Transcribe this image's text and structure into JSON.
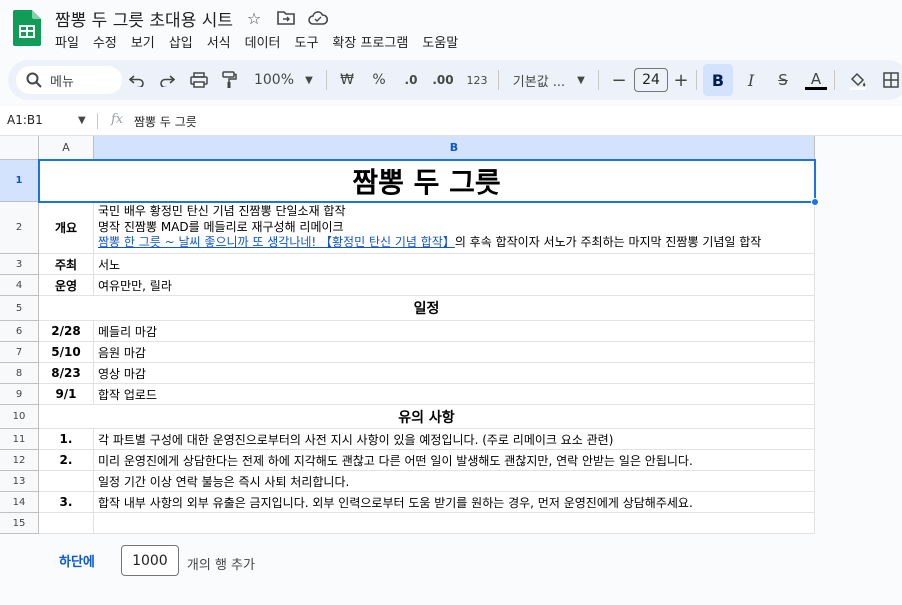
{
  "app": {
    "title": "짬뽕 두 그릇 초대용 시트",
    "colors": {
      "accent": "#1a73e8",
      "sheets_green": "#0f9d58",
      "link": "#1155cc"
    }
  },
  "menu": [
    "파일",
    "수정",
    "보기",
    "삽입",
    "서식",
    "데이터",
    "도구",
    "확장 프로그램",
    "도움말"
  ],
  "toolbar": {
    "search_label": "메뉴",
    "zoom": "100%",
    "currency": "₩",
    "percent": "%",
    "dec_decrease": ".0",
    "dec_increase": ".00",
    "number_format": "123",
    "font": "기본값 ...",
    "font_size": "24",
    "bold": "B",
    "italic": "I",
    "strike": "S",
    "text_color": "A"
  },
  "formula_bar": {
    "name_box": "A1:B1",
    "fx": "fx",
    "content": "짬뽕 두 그릇"
  },
  "columns": [
    "A",
    "B"
  ],
  "rows": [
    {
      "num": "1",
      "merged": "짬뽕 두 그릇"
    },
    {
      "num": "2",
      "a": "개요",
      "b_lines": [
        "국민 배우 황정민 탄신 기념 진짬뽕 단일소재 합작",
        "명작 진짬뽕 MAD를 메들리로 재구성해 리메이크"
      ],
      "b_link": "짬뽕 한 그릇 ~ 날씨 좋으니까 또 생각나네! 【황정민 탄신 기념 합작】",
      "b_tail": "의 후속 합작이자 서노가 주최하는 마지막 진짬뽕 기념일 합작"
    },
    {
      "num": "3",
      "a": "주최",
      "b": "서노"
    },
    {
      "num": "4",
      "a": "운영",
      "b": "여유만만, 릴라"
    },
    {
      "num": "5",
      "merged": "일정"
    },
    {
      "num": "6",
      "a": "2/28",
      "b": "메들리 마감"
    },
    {
      "num": "7",
      "a": "5/10",
      "b": "음원 마감"
    },
    {
      "num": "8",
      "a": "8/23",
      "b": "영상 마감"
    },
    {
      "num": "9",
      "a": "9/1",
      "b": "합작 업로드"
    },
    {
      "num": "10",
      "merged": "유의 사항"
    },
    {
      "num": "11",
      "a": "1.",
      "b": "각 파트별 구성에 대한 운영진으로부터의 사전 지시 사항이 있을 예정입니다. (주로 리메이크 요소 관련)"
    },
    {
      "num": "12",
      "a": "2.",
      "b": "미리 운영진에게 상담한다는 전제 하에 지각해도 괜찮고 다른 어떤 일이 발생해도 괜찮지만, 연락 안받는 일은 안됩니다."
    },
    {
      "num": "13",
      "a": "",
      "b": "일정 기간 이상 연락 불능은 즉시 사퇴 처리합니다."
    },
    {
      "num": "14",
      "a": "3.",
      "b": "합작 내부 사항의 외부 유출은 금지입니다. 외부 인력으로부터 도움 받기를 원하는 경우, 먼저 운영진에게 상담해주세요."
    },
    {
      "num": "15",
      "a": "",
      "b": ""
    }
  ],
  "footer": {
    "add_button": "하단에",
    "rows_count": "1000",
    "rows_label": "개의 행 추가"
  }
}
